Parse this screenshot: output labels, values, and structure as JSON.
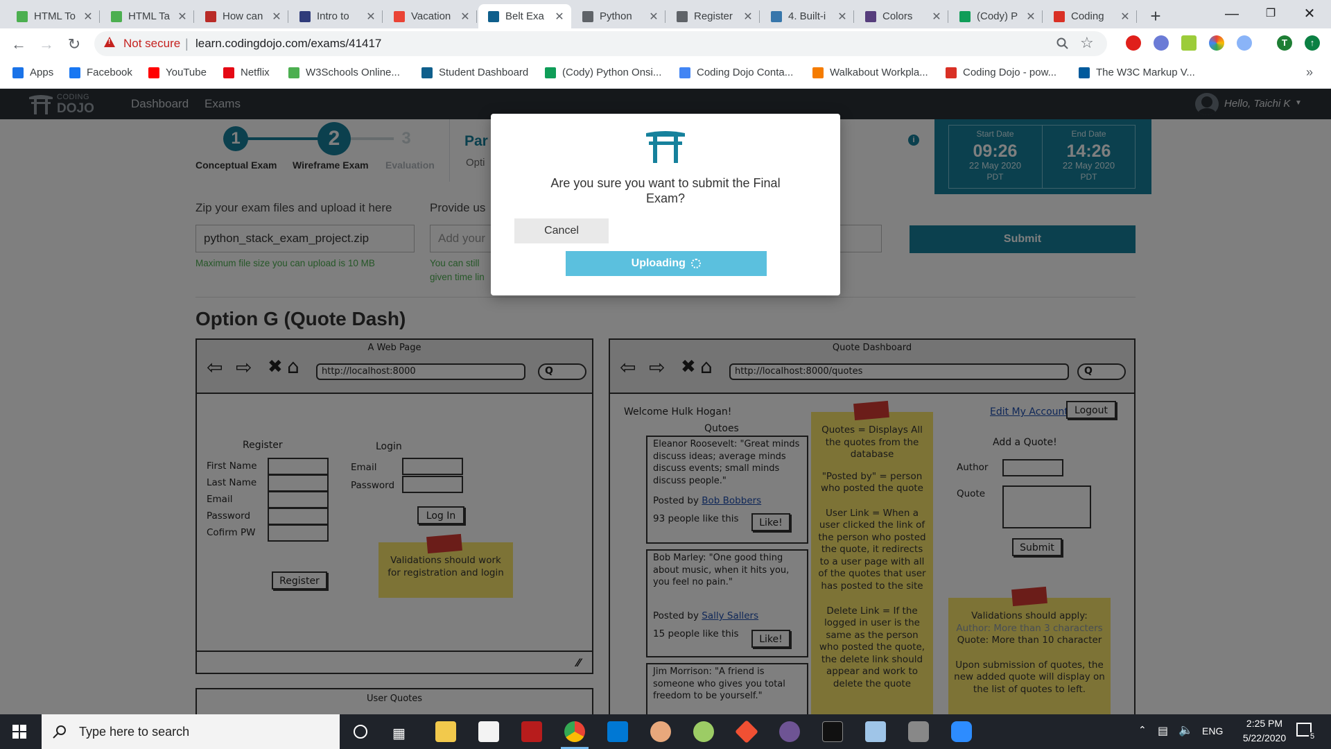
{
  "browser": {
    "tabs": [
      {
        "title": "HTML To",
        "icon": "w3schools-icon",
        "color": "#4caf50"
      },
      {
        "title": "HTML Ta",
        "icon": "w3schools-icon",
        "color": "#4caf50"
      },
      {
        "title": "How can",
        "icon": "quora-icon",
        "color": "#b92b27"
      },
      {
        "title": "Intro to",
        "icon": "bars-icon",
        "color": "#2f3b7a"
      },
      {
        "title": "Vacation",
        "icon": "gmail-icon",
        "color": "#ea4335"
      },
      {
        "title": "Belt Exa",
        "icon": "codingdojo-icon",
        "color": "#0f5f8c"
      },
      {
        "title": "Python",
        "icon": "globe-icon",
        "color": "#5f6368"
      },
      {
        "title": "Register",
        "icon": "globe-icon",
        "color": "#5f6368"
      },
      {
        "title": "4. Built-i",
        "icon": "python-icon",
        "color": "#3776ab"
      },
      {
        "title": "Colors",
        "icon": "bootstrap-icon",
        "color": "#563d7c"
      },
      {
        "title": "(Cody) P",
        "icon": "sheets-icon",
        "color": "#0f9d58"
      },
      {
        "title": "Coding",
        "icon": "chat-icon",
        "color": "#d93025"
      }
    ],
    "active_tab_index": 5,
    "url_warning": "Not secure",
    "url": "learn.codingdojo.com/exams/41417",
    "bookmarks": [
      {
        "label": "Apps",
        "icon": "apps-grid-icon",
        "color": "#1a73e8"
      },
      {
        "label": "Facebook",
        "icon": "facebook-icon",
        "color": "#1877f2"
      },
      {
        "label": "YouTube",
        "icon": "youtube-icon",
        "color": "#ff0000"
      },
      {
        "label": "Netflix",
        "icon": "netflix-icon",
        "color": "#e50914"
      },
      {
        "label": "W3Schools Online...",
        "icon": "w3schools-icon",
        "color": "#4caf50"
      },
      {
        "label": "Student Dashboard",
        "icon": "codingdojo-icon",
        "color": "#0f5f8c"
      },
      {
        "label": "(Cody) Python Onsi...",
        "icon": "sheets-icon",
        "color": "#0f9d58"
      },
      {
        "label": "Coding Dojo Conta...",
        "icon": "docs-icon",
        "color": "#4285f4"
      },
      {
        "label": "Walkabout Workpla...",
        "icon": "walkabout-icon",
        "color": "#f57c00"
      },
      {
        "label": "Coding Dojo - pow...",
        "icon": "chat-icon",
        "color": "#d93025"
      },
      {
        "label": "The W3C Markup V...",
        "icon": "w3c-icon",
        "color": "#005a9c"
      }
    ]
  },
  "site": {
    "logo_top": "CODING",
    "logo_bottom": "DOJO",
    "nav": [
      "Dashboard",
      "Exams"
    ],
    "greeting": "Hello, Taichi K"
  },
  "exam": {
    "steps": [
      {
        "num": "1",
        "label": "Conceptual Exam",
        "state": "done"
      },
      {
        "num": "2",
        "label": "Wireframe Exam",
        "state": "current"
      },
      {
        "num": "3",
        "label": "Evaluation",
        "state": "todo"
      }
    ],
    "part_title": "Par",
    "part_sub": "Opti",
    "start_label": "Start Date",
    "start_time": "09:26",
    "start_date": "22 May 2020",
    "start_tz": "PDT",
    "end_label": "End Date",
    "end_time": "14:26",
    "end_date": "22 May 2020",
    "end_tz": "PDT",
    "upload_label": "Zip your exam files and upload it here",
    "upload_value": "python_stack_exam_project.zip",
    "upload_hint": "Maximum file size you can upload is 10 MB",
    "provide_label": "Provide us",
    "provide_placeholder": "Add your",
    "provide_hint_1": "You can still",
    "provide_hint_2": "given time lin",
    "submit_label": "Submit",
    "option_title": "Option G (Quote Dash)"
  },
  "wf_left": {
    "title": "A Web Page",
    "url": "http://localhost:8000",
    "register_heading": "Register",
    "register_fields": [
      "First Name",
      "Last Name",
      "Email",
      "Password",
      "Cofirm PW"
    ],
    "register_button": "Register",
    "login_heading": "Login",
    "login_fields": [
      "Email",
      "Password"
    ],
    "login_button": "Log In",
    "note": "Validations should work for registration and login",
    "next_title": "User Quotes"
  },
  "wf_right": {
    "title": "Quote Dashboard",
    "url": "http://localhost:8000/quotes",
    "welcome": "Welcome Hulk Hogan!",
    "edit_link": "Edit My Account",
    "logout": "Logout",
    "quotes_heading": "Qutoes",
    "quotes": [
      {
        "text": "Eleanor Roosevelt: \"Great minds discuss ideas; average minds discuss events; small minds discuss people.\"",
        "posted_prefix": "Posted by",
        "author": "Bob Bobbers",
        "likes": "93 people like this",
        "button": "Like!"
      },
      {
        "text": "Bob Marley: \"One good thing about music, when it hits you, you feel no pain.\"",
        "posted_prefix": "Posted by",
        "author": "Sally Sallers",
        "likes": "15 people like this",
        "button": "Like!"
      },
      {
        "text": "Jim Morrison: \"A friend is someone who gives you total freedom to be yourself.\"",
        "posted_prefix": "",
        "author": "",
        "likes": "",
        "button": ""
      }
    ],
    "note_center": [
      "Quotes = Displays All the quotes from the database",
      "\"Posted by\" = person who posted the quote",
      "User Link = When a user clicked the link of the person who posted the quote, it redirects to a user page with all of the quotes that user has posted to the site",
      "Delete Link = If the logged in user is the same as the person who posted the quote, the delete link should appear and work to delete the quote"
    ],
    "add_heading": "Add a Quote!",
    "author_label": "Author",
    "quote_label": "Quote",
    "add_submit": "Submit",
    "note_right_title": "Validations should apply:",
    "note_right_author": "Author: More than 3 characters",
    "note_right_quote": "Quote: More than 10 character",
    "note_right_body": "Upon submission of quotes, the new added quote will display on the list of quotes to left."
  },
  "modal": {
    "question": "Are you sure you want to submit the Final Exam?",
    "cancel": "Cancel",
    "uploading": "Uploading"
  },
  "taskbar": {
    "search_placeholder": "Type here to search",
    "lang": "ENG",
    "time": "2:25 PM",
    "date": "5/22/2020",
    "notif_count": "5"
  }
}
